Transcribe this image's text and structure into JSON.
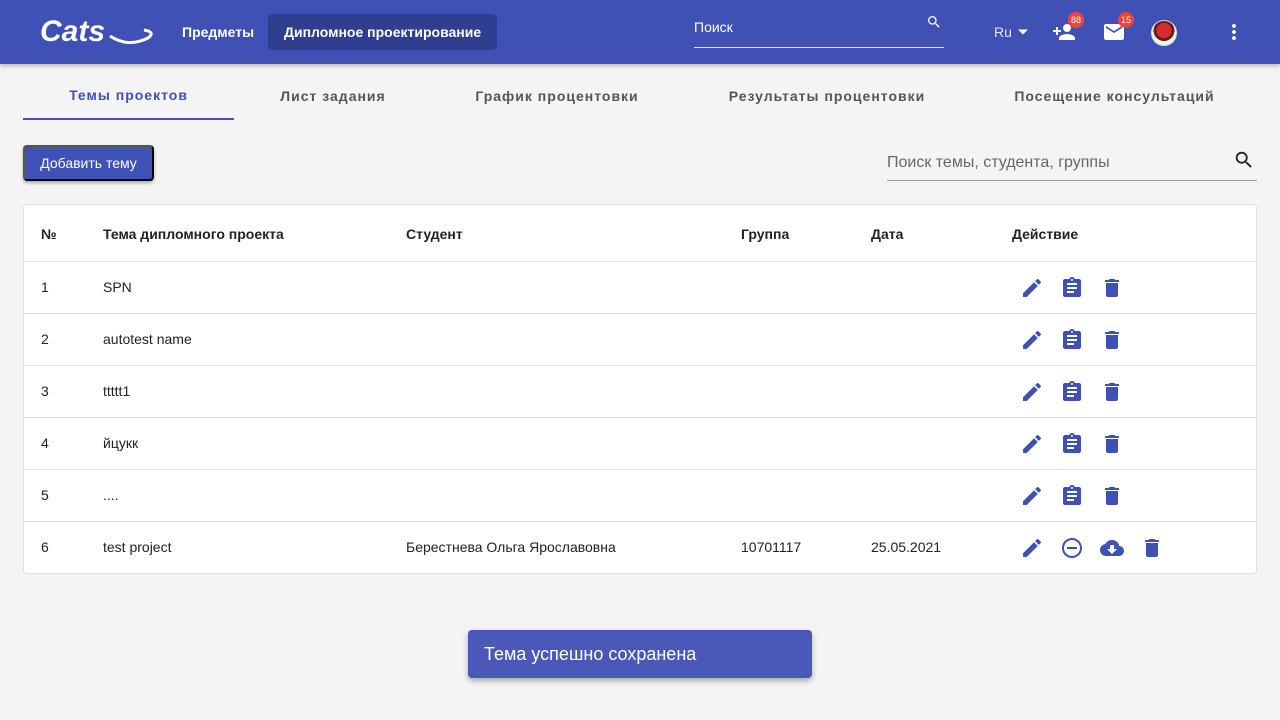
{
  "colors": {
    "primary": "#3f51b5",
    "badge": "#f44336",
    "background": "#f4f4f4"
  },
  "header": {
    "logo_text": "Cats",
    "nav": [
      {
        "label": "Предметы"
      },
      {
        "label": "Дипломное проектирование",
        "active": true
      }
    ],
    "search_placeholder": "Поиск",
    "language": "Ru",
    "badges": {
      "add_user": "88",
      "mail": "15"
    }
  },
  "tabs": [
    {
      "label": "Темы проектов",
      "active": true
    },
    {
      "label": "Лист задания"
    },
    {
      "label": "График процентовки"
    },
    {
      "label": "Результаты процентовки"
    },
    {
      "label": "Посещение консультаций"
    }
  ],
  "toolbar": {
    "add_label": "Добавить тему",
    "search_placeholder": "Поиск темы, студента, группы"
  },
  "table": {
    "columns": [
      "№",
      "Тема дипломного проекта",
      "Студент",
      "Группа",
      "Дата",
      "Действие"
    ],
    "rows": [
      {
        "num": "1",
        "topic": "SPN",
        "student": "",
        "group": "",
        "date": "",
        "actions": [
          "edit-icon",
          "assignment-icon",
          "delete-icon"
        ]
      },
      {
        "num": "2",
        "topic": "autotest name",
        "student": "",
        "group": "",
        "date": "",
        "actions": [
          "edit-icon",
          "assignment-icon",
          "delete-icon"
        ]
      },
      {
        "num": "3",
        "topic": "ttttt1",
        "student": "",
        "group": "",
        "date": "",
        "actions": [
          "edit-icon",
          "assignment-icon",
          "delete-icon"
        ]
      },
      {
        "num": "4",
        "topic": "йцукк",
        "student": "",
        "group": "",
        "date": "",
        "actions": [
          "edit-icon",
          "assignment-icon",
          "delete-icon"
        ]
      },
      {
        "num": "5",
        "topic": "....",
        "student": "",
        "group": "",
        "date": "",
        "actions": [
          "edit-icon",
          "assignment-icon",
          "delete-icon"
        ]
      },
      {
        "num": "6",
        "topic": "test project",
        "student": "Берестнева Ольга Ярославовна",
        "group": "10701117",
        "date": "25.05.2021",
        "actions": [
          "edit-icon",
          "remove-circle-icon",
          "cloud-download-icon",
          "delete-icon"
        ]
      }
    ]
  },
  "snackbar": {
    "message": "Тема успешно сохранена"
  }
}
